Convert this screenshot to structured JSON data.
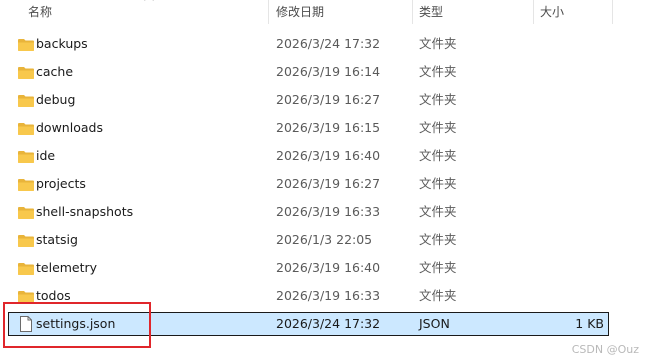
{
  "columns": {
    "name": "名称",
    "date": "修改日期",
    "type": "类型",
    "size": "大小"
  },
  "rows": [
    {
      "name": "backups",
      "date": "2026/3/24 17:32",
      "type": "文件夹",
      "size": "",
      "icon": "folder-icon"
    },
    {
      "name": "cache",
      "date": "2026/3/19 16:14",
      "type": "文件夹",
      "size": "",
      "icon": "folder-icon"
    },
    {
      "name": "debug",
      "date": "2026/3/19 16:27",
      "type": "文件夹",
      "size": "",
      "icon": "folder-icon"
    },
    {
      "name": "downloads",
      "date": "2026/3/19 16:15",
      "type": "文件夹",
      "size": "",
      "icon": "folder-icon"
    },
    {
      "name": "ide",
      "date": "2026/3/19 16:40",
      "type": "文件夹",
      "size": "",
      "icon": "folder-icon"
    },
    {
      "name": "projects",
      "date": "2026/3/19 16:27",
      "type": "文件夹",
      "size": "",
      "icon": "folder-icon"
    },
    {
      "name": "shell-snapshots",
      "date": "2026/3/19 16:33",
      "type": "文件夹",
      "size": "",
      "icon": "folder-icon"
    },
    {
      "name": "statsig",
      "date": "2026/1/3 22:05",
      "type": "文件夹",
      "size": "",
      "icon": "folder-icon"
    },
    {
      "name": "telemetry",
      "date": "2026/3/19 16:40",
      "type": "文件夹",
      "size": "",
      "icon": "folder-icon"
    },
    {
      "name": "todos",
      "date": "2026/3/19 16:33",
      "type": "文件夹",
      "size": "",
      "icon": "folder-icon"
    },
    {
      "name": "settings.json",
      "date": "2026/3/24 17:32",
      "type": "JSON",
      "size": "1 KB",
      "icon": "file-icon",
      "selected": true
    }
  ],
  "watermark": "CSDN @Ouz",
  "colors": {
    "folder": "#f8c84c",
    "selection": "#cce8ff",
    "annotation": "#e0262b"
  }
}
